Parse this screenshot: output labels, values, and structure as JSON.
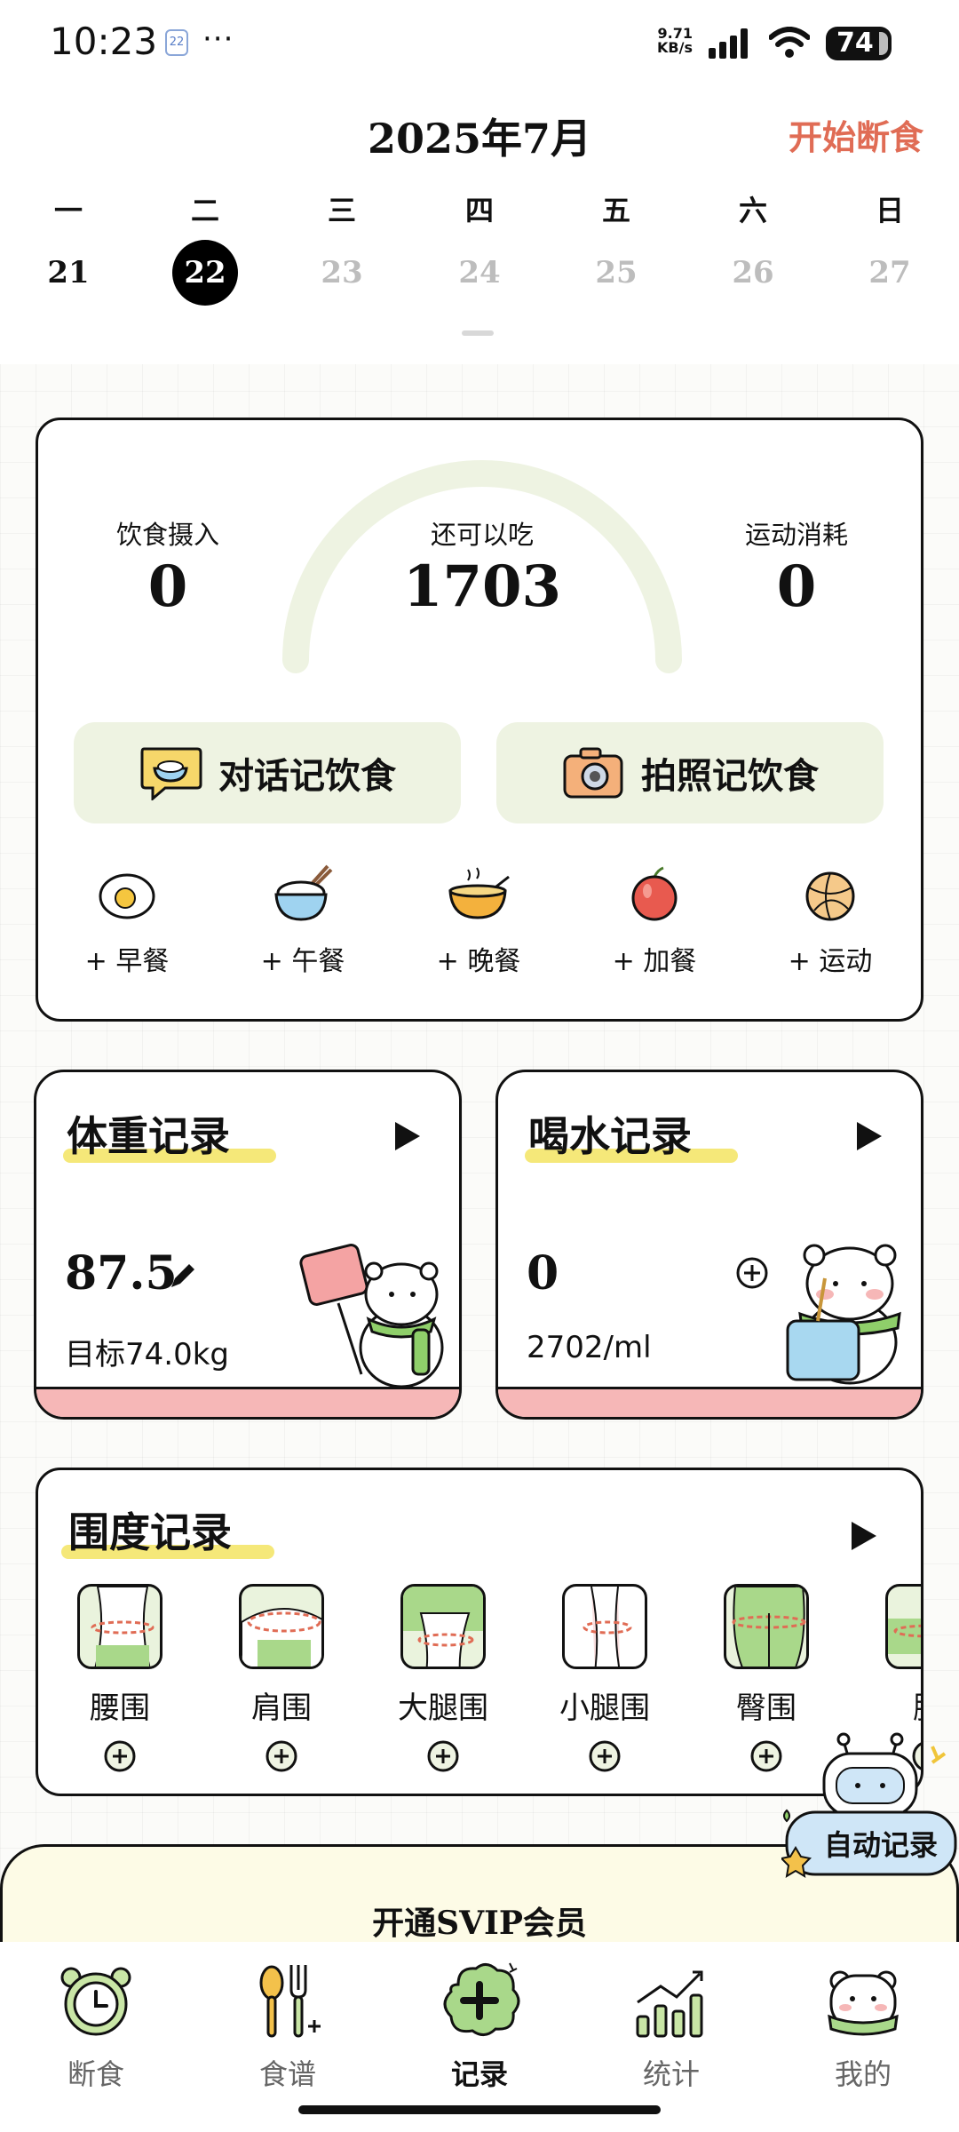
{
  "status_bar": {
    "time": "10:23",
    "calendar_badge": "22",
    "more": "···",
    "net_speed_value": "9.71",
    "net_speed_unit": "KB/s",
    "battery": "74"
  },
  "header": {
    "month": "2025年7月",
    "start_fast": "开始断食",
    "weekdays": [
      "一",
      "二",
      "三",
      "四",
      "五",
      "六",
      "日"
    ],
    "dates": [
      "21",
      "22",
      "23",
      "24",
      "25",
      "26",
      "27"
    ],
    "selected_date": "22"
  },
  "calorie": {
    "intake_label": "饮食摄入",
    "intake_value": "0",
    "remaining_label": "还可以吃",
    "remaining_value": "1703",
    "burn_label": "运动消耗",
    "burn_value": "0",
    "progress_fraction": 0
  },
  "actions": {
    "chat_log": "对话记饮食",
    "photo_log": "拍照记饮食"
  },
  "meals": [
    "+ 早餐",
    "+ 午餐",
    "+ 晚餐",
    "+ 加餐",
    "+ 运动"
  ],
  "weight_card": {
    "title": "体重记录",
    "value": "87.5",
    "target": "目标74.0kg"
  },
  "water_card": {
    "title": "喝水记录",
    "value": "0",
    "target": "2702/ml"
  },
  "circumference": {
    "title": "围度记录",
    "items": [
      "腰围",
      "肩围",
      "大腿围",
      "小腿围",
      "臀围",
      "胸"
    ]
  },
  "auto_record": "自动记录",
  "svip": "开通SVIP会员",
  "tabs": [
    {
      "label": "断食",
      "icon": "clock-icon"
    },
    {
      "label": "食谱",
      "icon": "utensils-icon"
    },
    {
      "label": "记录",
      "icon": "plus-cloud-icon"
    },
    {
      "label": "统计",
      "icon": "bar-chart-icon"
    },
    {
      "label": "我的",
      "icon": "bear-face-icon"
    }
  ],
  "active_tab": "记录",
  "colors": {
    "accent_orange": "#e06c55",
    "card_green": "#eef3e2",
    "highlight_yellow": "#f4e66a",
    "card_pink": "#f6b7b7",
    "svip_bg": "#fdfbe6"
  }
}
